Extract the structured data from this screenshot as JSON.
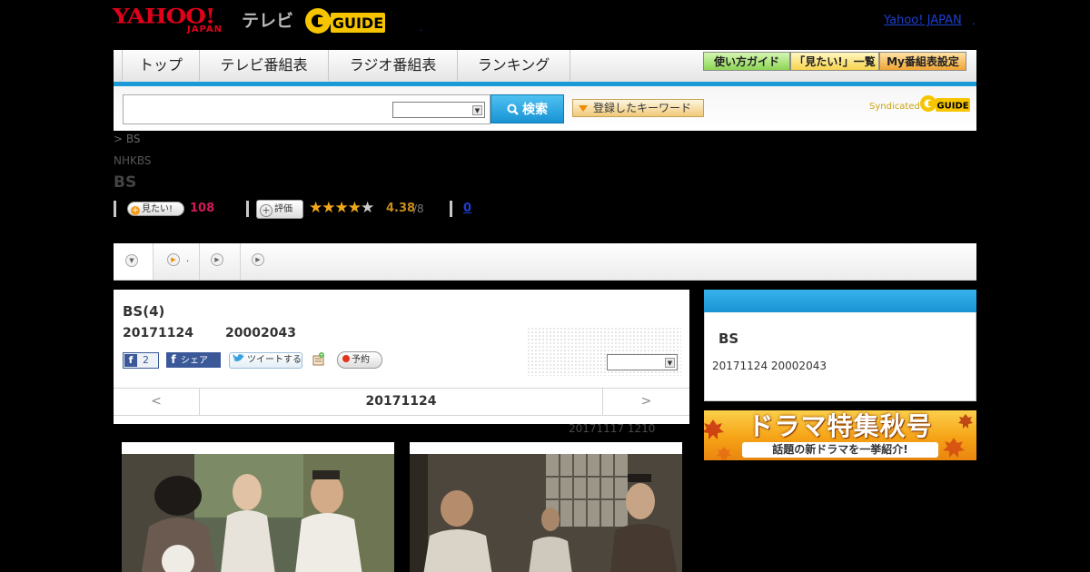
{
  "header": {
    "yahoo_logo": "YAHOO!",
    "yahoo_sub": "JAPAN",
    "tv_label": "テレビ",
    "gguide_logo": "G-GUIDE",
    "dot": ".",
    "top_link": "Yahoo! JAPAN",
    "top_link_dot": "."
  },
  "nav": {
    "items": [
      "トップ",
      "テレビ番組表",
      "ラジオ番組表",
      "ランキング"
    ],
    "buttons": [
      "使い方ガイド",
      "「見たい!」一覧",
      "My番組表設定"
    ],
    "button_colors": [
      "#9ee36a",
      "#ffe27a",
      "#f7b54a"
    ]
  },
  "search": {
    "placeholder": "",
    "select_value": "",
    "button_label": "検索",
    "keyword_button": "登録したキーワード",
    "syndicated": "Syndicated"
  },
  "program": {
    "breadcrumb": "> BS",
    "channel": "NHKBS",
    "title": "BS",
    "mitai_label": "見たい!",
    "mitai_count": "108",
    "rate_label": "評価",
    "stars_filled": 4,
    "stars_total": 5,
    "rating": "4.38",
    "rating_count": "/8",
    "link_count": "0"
  },
  "tabs": [
    {
      "label": ""
    },
    {
      "label": "."
    },
    {
      "label": ""
    },
    {
      "label": ""
    }
  ],
  "episode": {
    "title": "BS(4)",
    "date": "20171124",
    "time": "20002043",
    "fb_like_count": "2",
    "fb_share": "シェア",
    "tweet": "ツイートする",
    "reserve": "予約",
    "select_value": "",
    "nav_prev": "<",
    "nav_date": "20171124",
    "nav_next": ">",
    "update_note": "20171117  1210"
  },
  "sidebar": {
    "title": "BS",
    "date": "20171124  20002043",
    "banner_title": "ドラマ特集秋号",
    "banner_sub": "話題の新ドラマを一挙紹介!"
  },
  "colors": {
    "accent_blue": "#1a9ad6",
    "mitai_count": "#d2195a",
    "rating": "#c98c1a",
    "link": "#1c3fcf"
  }
}
